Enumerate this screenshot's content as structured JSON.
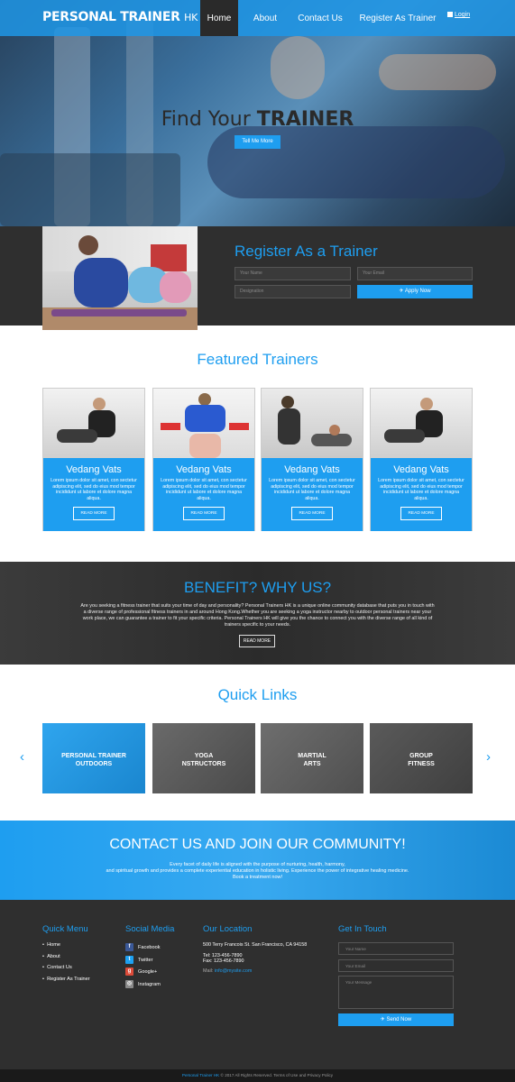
{
  "nav": {
    "brand": "PERSONAL TRAINER",
    "brand_suffix": "HK",
    "items": [
      {
        "label": "Home"
      },
      {
        "label": "About"
      },
      {
        "label": "Contact Us"
      },
      {
        "label": "Register As Trainer"
      }
    ],
    "login": "Login"
  },
  "hero": {
    "title_light": "Find Your",
    "title_bold": "TRAINER",
    "button": "Tell Me More"
  },
  "register": {
    "title": "Register As a Trainer",
    "fields": {
      "name": "Your Name",
      "email": "Your Email",
      "designation": "Designation"
    },
    "button": "Apply Now"
  },
  "featured": {
    "title": "Featured Trainers",
    "cards": [
      {
        "name": "Vedang Vats",
        "text": "Lorem ipsum dolor sit amet, con sectetur adipiscing elit, sed do eius mod tempor incididunt ut labore et dolore magna aliqua.",
        "button": "READ MORE"
      },
      {
        "name": "Vedang Vats",
        "text": "Lorem ipsum dolor sit amet, con sectetur adipiscing elit, sed do eius mod tempor incididunt ut labore et dolore magna aliqua.",
        "button": "READ MORE"
      },
      {
        "name": "Vedang Vats",
        "text": "Lorem ipsum dolor sit amet, con sectetur adipiscing elit, sed do eius mod tempor incididunt ut labore et dolore magna aliqua.",
        "button": "READ MORE"
      },
      {
        "name": "Vedang Vats",
        "text": "Lorem ipsum dolor sit amet, con sectetur adipiscing elit, sed do eius mod tempor incididunt ut labore et dolore magna aliqua.",
        "button": "READ MORE"
      }
    ]
  },
  "benefit": {
    "title": "BENEFIT? WHY US?",
    "text": "Are you seeking a fitness trainer that suits your time of day and personality? Personal Trainers HK is a unique online community database that puts you in touch with a diverse range of professional fitness trainers in and around Hong Kong.Whether you are seeking a yoga instructor nearby to outdoor personal trainers near your work place, we can guarantee a trainer to fit your specific criteria. Personal Trainers HK will give you the chance to connect you with the diverse range of all kind of trainers specific to your needs.",
    "button": "READ MORE"
  },
  "quicklinks": {
    "title": "Quick Links",
    "items": [
      {
        "line1": "PERSONAL TRAINER",
        "line2": "OUTDOORS"
      },
      {
        "line1": "YOGA",
        "line2": "NSTRUCTORS"
      },
      {
        "line1": "MARTIAL",
        "line2": "ARTS"
      },
      {
        "line1": "GROUP",
        "line2": "FITNESS"
      }
    ]
  },
  "contact_banner": {
    "title": "CONTACT US AND JOIN OUR COMMUNITY!",
    "line1": "Every facet of daily life is aligned with the purpose of nurturing, health, harmony,",
    "line2": "and spiritual growth and provides a complete experiential education in holistic living. Experience the power of integrative healing medicine.",
    "line3": "Book a treatment now!"
  },
  "footer": {
    "quick_menu": {
      "title": "Quick Menu",
      "items": [
        "Home",
        "About",
        "Contact Us",
        "Register As Trainer"
      ]
    },
    "social": {
      "title": "Social Media",
      "items": [
        "Facebook",
        "Twitter",
        "Google+",
        "Instagram"
      ]
    },
    "location": {
      "title": "Our Location",
      "address": "500 Terry Francois St. San Francisco, CA 94158",
      "tel": "Tel: 123-456-7890",
      "fax": "Fax: 123-456-7890",
      "mail_label": "Mail:",
      "mail": "info@mysite.com"
    },
    "get_in_touch": {
      "title": "Get In Touch",
      "name": "Your Name",
      "email": "Your Email",
      "message": "Your Message",
      "button": "Send Now"
    }
  },
  "bottom_bar": {
    "brand": "Personal Trainer HK",
    "text": "© 2017 All Rights Reserved. Terms of Use and Privacy Policy"
  },
  "colors": {
    "accent": "#1e9ef0",
    "dark": "#2f2f2f"
  }
}
